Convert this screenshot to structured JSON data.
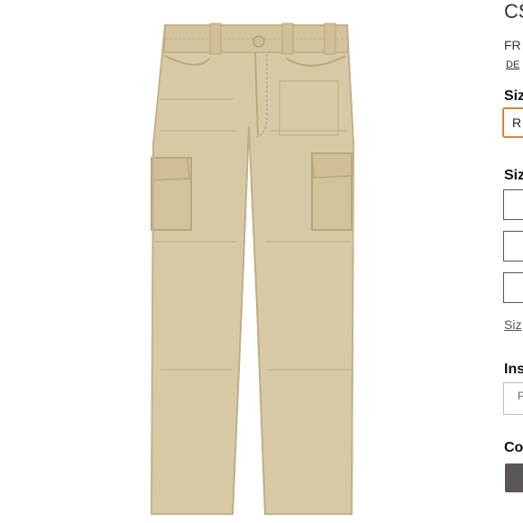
{
  "product": {
    "title": "CS",
    "image_alt": "Khaki cargo pants",
    "shipping": "FR",
    "details_link": "DE"
  },
  "size_type": {
    "label": "Siz",
    "selected": "R"
  },
  "size": {
    "label": "Siz",
    "options": [
      "",
      "",
      ""
    ],
    "chart_link": "Siz"
  },
  "inseam": {
    "label": "Ins",
    "selected": "P"
  },
  "color": {
    "label": "Co",
    "swatch": "#5a5656"
  },
  "colors": {
    "pant": "#d8c9a6",
    "pant_shadow": "#c4b48e",
    "stitch": "#bba878",
    "accent": "#d4853a"
  }
}
